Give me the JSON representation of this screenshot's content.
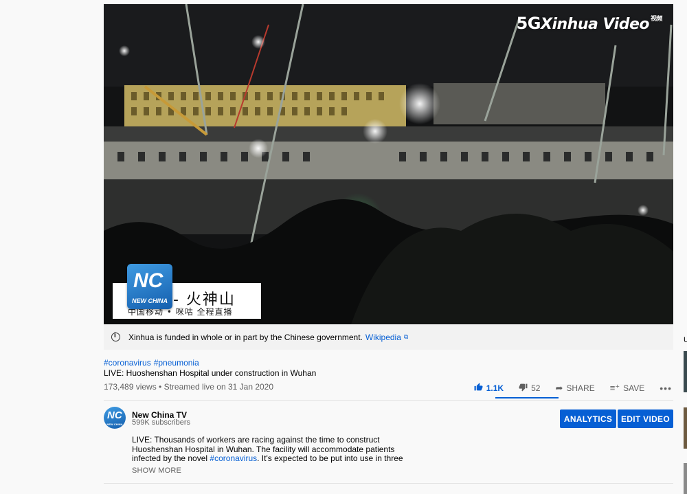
{
  "video": {
    "watermark_brand": "Xinhua Video",
    "watermark_prefix": "5G",
    "watermark_sub": "视频",
    "logo_mark": "NC",
    "logo_text": "NEW CHINA",
    "lower_third_main": "- 火神山",
    "lower_third_sub": "中国移动 • 咪咕  全程直播"
  },
  "info_bar": {
    "text": "Xinhua is funded in whole or in part by the Chinese government.",
    "link": "Wikipedia"
  },
  "hashtags": [
    "#coronavirus",
    "#pneumonia"
  ],
  "title": "LIVE: Huoshenshan Hospital under construction in Wuhan",
  "meta": "173,489 views • Streamed live on 31 Jan 2020",
  "actions": {
    "likes": "1.1K",
    "dislikes": "52",
    "share": "SHARE",
    "save": "SAVE",
    "more": "•••"
  },
  "channel": {
    "name": "New China TV",
    "subscribers": "599K subscribers",
    "avatar_mark": "NC",
    "avatar_text": "NEW CHINA"
  },
  "buttons": {
    "analytics": "ANALYTICS",
    "edit_video": "EDIT VIDEO"
  },
  "description": {
    "part1": "LIVE: Thousands of workers are racing against the time to construct Huoshenshan Hospital in Wuhan. The facility will accommodate patients infected by the novel ",
    "hashtag": "#coronavirus",
    "part2": ". It's expected to be put into use in three"
  },
  "show_more": "SHOW MORE",
  "sidebar_letter": "U",
  "colors": {
    "link": "#065fd4",
    "button": "#065fd4",
    "background": "#f9f9f9",
    "info_bar": "#f2f2f2"
  }
}
